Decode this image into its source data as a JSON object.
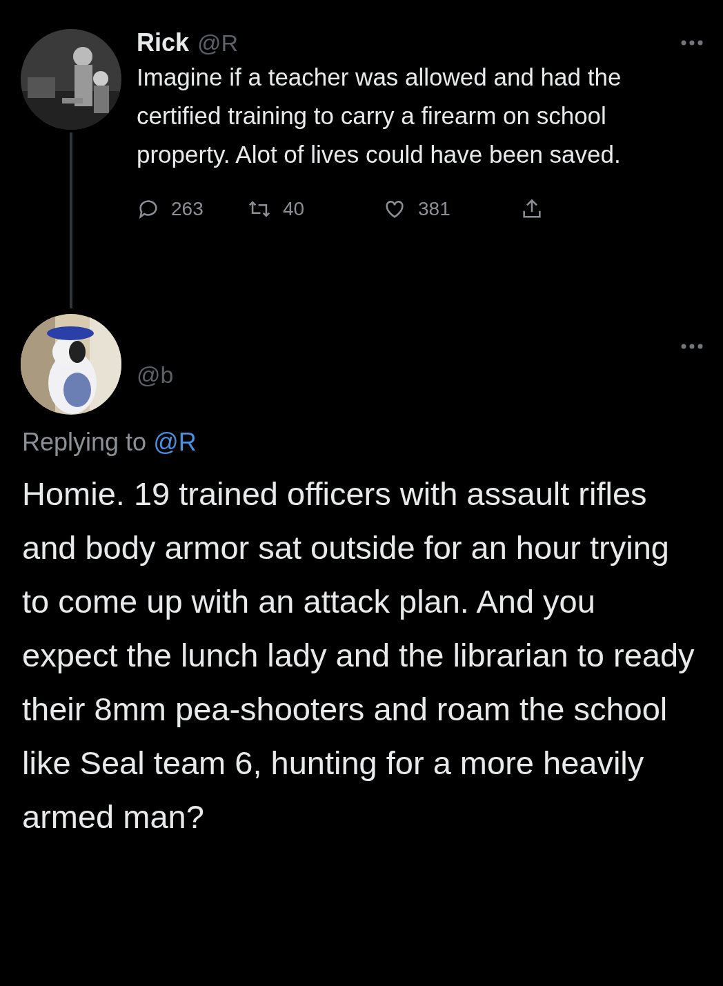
{
  "parent_tweet": {
    "name": "Rick",
    "handle": "@R",
    "text": "Imagine if a teacher was allowed and had the certified training to carry a firearm on school property. Alot of lives could have been saved.",
    "actions": [
      {
        "kind": "reply",
        "count": "263"
      },
      {
        "kind": "retweet",
        "count": "40"
      },
      {
        "kind": "like",
        "count": "381"
      },
      {
        "kind": "share"
      }
    ]
  },
  "reply_tweet": {
    "handle": "@b",
    "replying_to_label": "Replying to",
    "replying_to_handle": "@R",
    "text": "Homie. 19 trained officers with assault rifles and body armor sat outside for an hour trying to come up with an attack plan. And you expect the lunch lady and the librarian to ready their 8mm pea-shooters and roam the school like Seal team 6, hunting for a more heavily armed man?"
  }
}
